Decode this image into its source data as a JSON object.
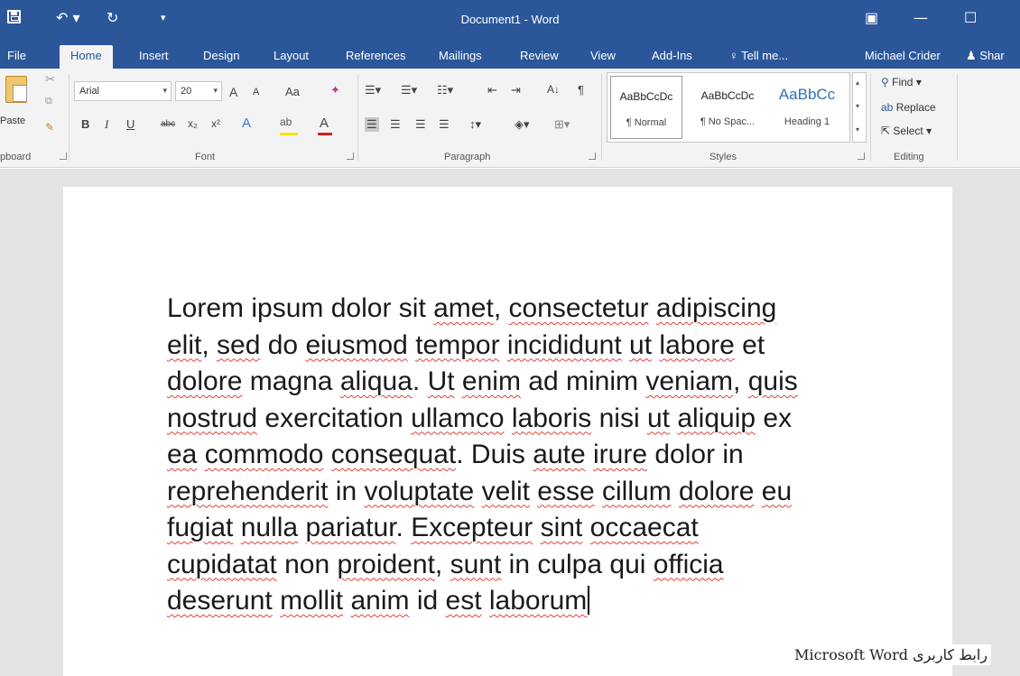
{
  "window": {
    "title": "Document1 - Word",
    "accent_color": "#2b579a"
  },
  "quick_access": {
    "save_icon": "save-icon",
    "undo_label": "↶ ▾",
    "redo_label": "↻",
    "customize_label": "▾"
  },
  "window_controls": {
    "ribbon_display": "▣",
    "minimize": "—",
    "maximize": "☐"
  },
  "tabs": [
    {
      "label": "File"
    },
    {
      "label": "Home",
      "active": true
    },
    {
      "label": "Insert"
    },
    {
      "label": "Design"
    },
    {
      "label": "Layout"
    },
    {
      "label": "References"
    },
    {
      "label": "Mailings"
    },
    {
      "label": "Review"
    },
    {
      "label": "View"
    },
    {
      "label": "Add-Ins"
    }
  ],
  "tell_me": {
    "icon": "lightbulb-icon",
    "placeholder": "Tell me..."
  },
  "user": {
    "name": "Michael Crider",
    "share_label": "Shar"
  },
  "clipboard": {
    "paste_label": "Paste",
    "group_label": "pboard"
  },
  "font": {
    "family": "Arial",
    "size": "20",
    "grow_label": "A",
    "shrink_label": "A",
    "case_label": "Aa",
    "bold_label": "B",
    "italic_label": "I",
    "underline_label": "U",
    "strike_label": "abc",
    "subscript_label": "x₂",
    "superscript_label": "x²",
    "text_effects_label": "A",
    "highlight_label": "ab",
    "font_color_label": "A",
    "group_label": "Font"
  },
  "paragraph": {
    "group_label": "Paragraph",
    "sort_label": "A↓",
    "pilcrow_label": "¶"
  },
  "styles": {
    "group_label": "Styles",
    "items": [
      {
        "sample": "AaBbCcDc",
        "name": "¶ Normal"
      },
      {
        "sample": "AaBbCcDc",
        "name": "¶ No Spac..."
      },
      {
        "sample": "AaBbCc",
        "name": "Heading 1"
      }
    ]
  },
  "editing": {
    "group_label": "Editing",
    "find_label": "Find",
    "replace_label": "Replace",
    "select_label": "Select"
  },
  "document": {
    "lines": [
      [
        "Lorem ipsum dolor sit ",
        "amet",
        ", ",
        "consectetur",
        " ",
        "adipiscing"
      ],
      [
        "elit",
        ", ",
        "sed",
        " do ",
        "eiusmod",
        " ",
        "tempor",
        " ",
        "incididunt",
        " ",
        "ut",
        " ",
        "labore",
        " et"
      ],
      [
        "dolore",
        " magna ",
        "aliqua",
        ". ",
        "Ut",
        " ",
        "enim",
        " ad minim ",
        "veniam",
        ", ",
        "quis"
      ],
      [
        "nostrud",
        " exercitation ",
        "ullamco",
        " ",
        "laboris",
        " nisi ",
        "ut",
        " ",
        "aliquip",
        " ex"
      ],
      [
        "ea",
        " ",
        "commodo",
        " ",
        "consequat",
        ". Duis ",
        "aute",
        " ",
        "irure",
        " dolor in"
      ],
      [
        "reprehenderit",
        " in ",
        "voluptate",
        " ",
        "velit",
        " ",
        "esse",
        " ",
        "cillum",
        " ",
        "dolore",
        " ",
        "eu"
      ],
      [
        "fugiat",
        " ",
        "nulla",
        " ",
        "pariatur",
        ". ",
        "Excepteur",
        " ",
        "sint",
        " ",
        "occaecat"
      ],
      [
        "cupidatat",
        " non ",
        "proident",
        ", ",
        "sunt",
        " in culpa qui ",
        "officia"
      ],
      [
        "deserunt",
        " ",
        "mollit",
        " ",
        "anim",
        " id ",
        "est",
        " ",
        "laborum"
      ]
    ]
  },
  "caption": "رابط کاربری Microsoft Word"
}
